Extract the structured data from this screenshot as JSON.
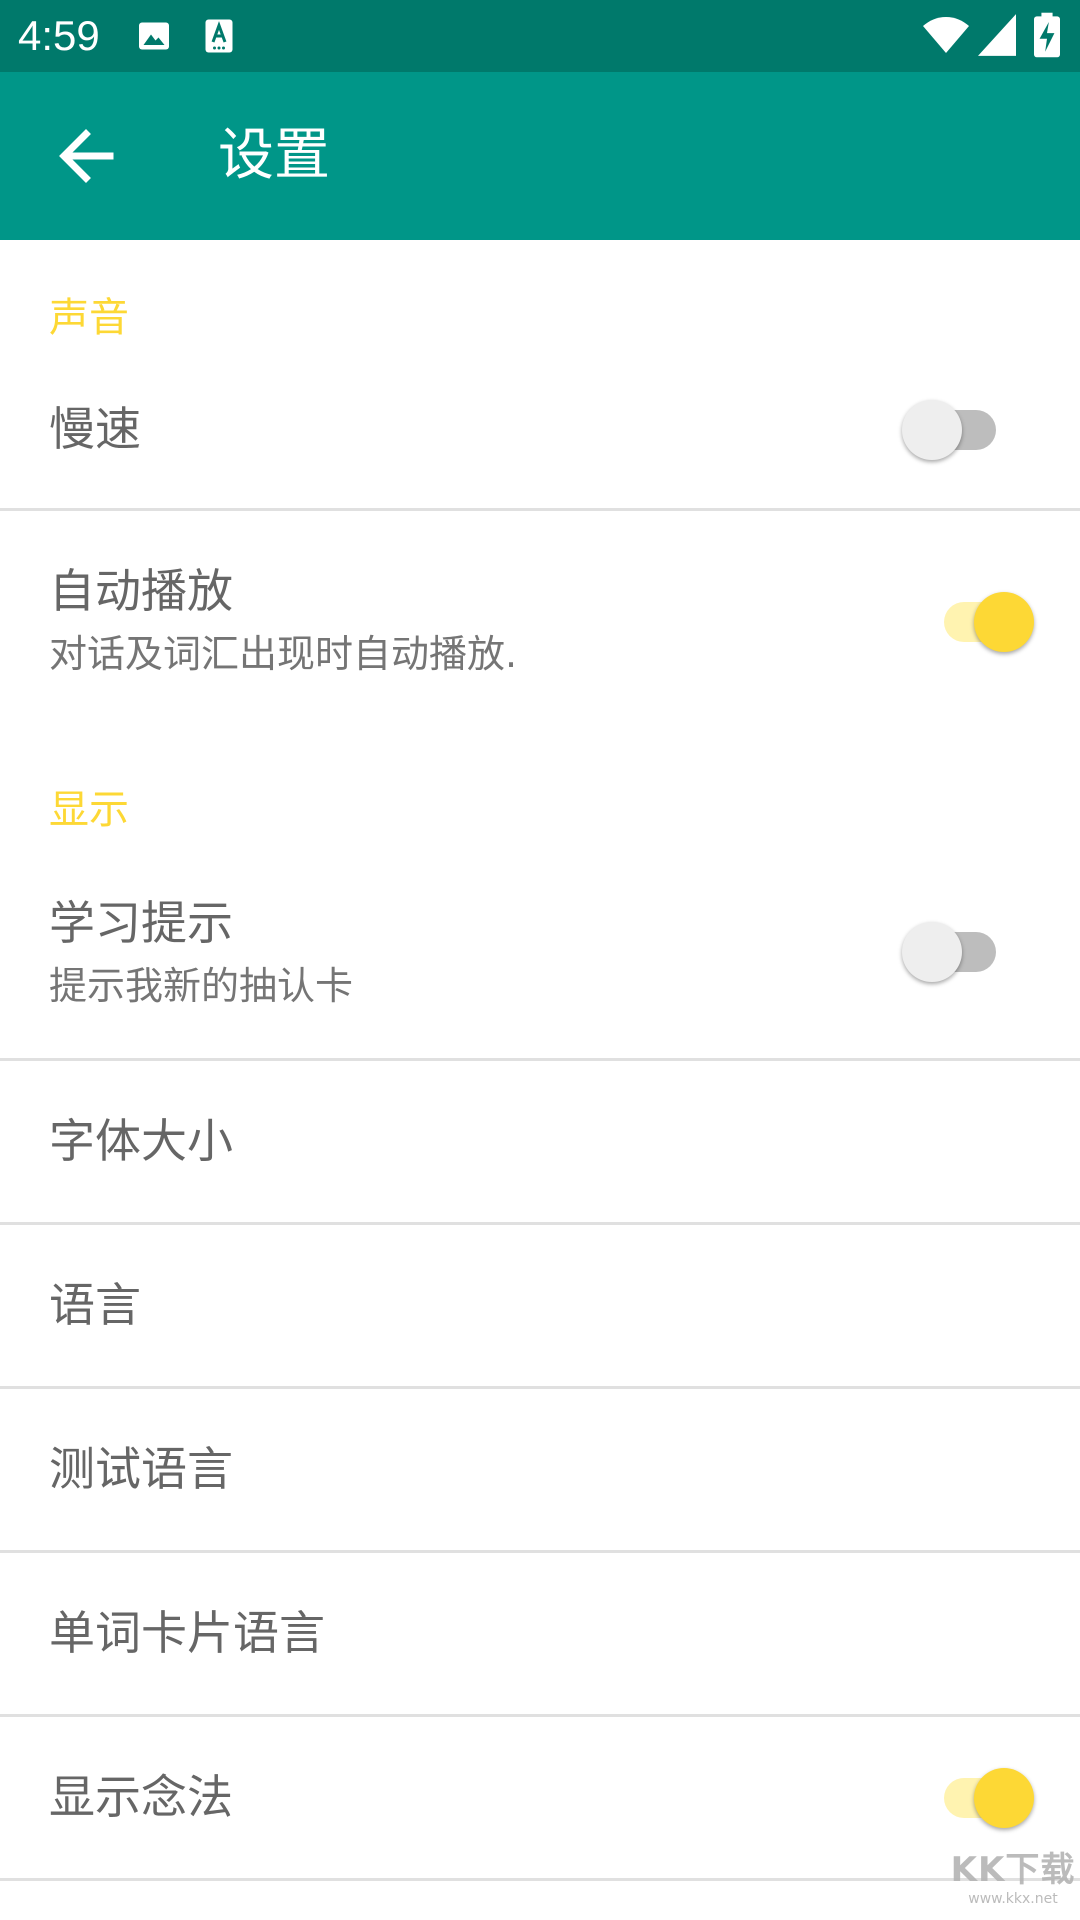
{
  "status_bar": {
    "time": "4:59",
    "icons": [
      "image-icon",
      "keyboard-a-icon",
      "wifi-icon",
      "signal-icon",
      "battery-charging-icon"
    ]
  },
  "app_bar": {
    "title": "设置",
    "back_icon": "arrow-left-icon"
  },
  "sections": {
    "sound": {
      "header": "声音",
      "slow_speed": {
        "title": "慢速",
        "enabled": false
      },
      "autoplay": {
        "title": "自动播放",
        "summary": "对话及词汇出现时自动播放.",
        "enabled": true
      }
    },
    "display": {
      "header": "显示",
      "study_hint": {
        "title": "学习提示",
        "summary": "提示我新的抽认卡",
        "enabled": false
      },
      "font_size": {
        "title": "字体大小"
      },
      "language": {
        "title": "语言"
      },
      "test_language": {
        "title": "测试语言"
      },
      "word_card_language": {
        "title": "单词卡片语言"
      },
      "show_pronunciation": {
        "title": "显示念法",
        "enabled": true
      }
    }
  },
  "watermark": {
    "main": "KK下载",
    "sub": "www.kkx.net"
  },
  "colors": {
    "status_bar": "#00796b",
    "app_bar": "#009688",
    "accent": "#fdd835",
    "text_primary": "#666666",
    "divider": "#e0e0e0"
  }
}
